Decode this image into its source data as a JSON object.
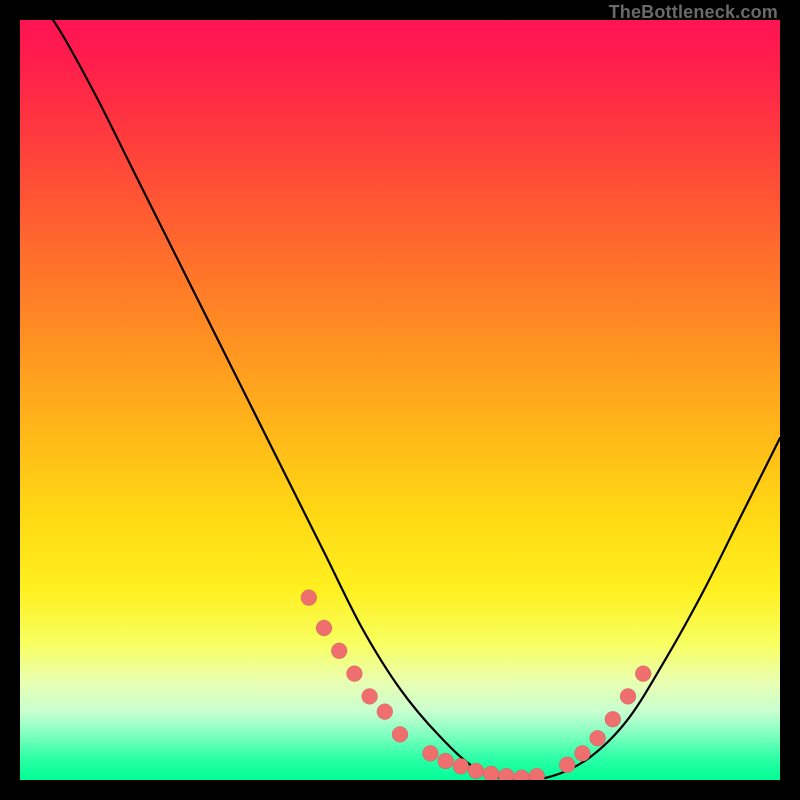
{
  "watermark": "TheBottleneck.com",
  "colors": {
    "background": "#000000",
    "gradient_top": "#ff1454",
    "gradient_bottom": "#00ff98",
    "curve": "#000000",
    "dot": "#ef6f6f"
  },
  "chart_data": {
    "type": "line",
    "title": "",
    "xlabel": "",
    "ylabel": "",
    "xlim": [
      0,
      100
    ],
    "ylim": [
      0,
      100
    ],
    "x": [
      0,
      5,
      10,
      15,
      20,
      25,
      30,
      35,
      40,
      45,
      50,
      55,
      60,
      65,
      70,
      75,
      80,
      85,
      90,
      95,
      100
    ],
    "values": [
      106,
      99,
      90,
      80,
      70,
      60,
      50,
      40,
      30,
      20,
      12,
      6,
      1.5,
      0,
      0.5,
      3,
      8,
      16,
      25,
      35,
      45
    ],
    "dots_x": [
      38,
      40,
      42,
      44,
      46,
      48,
      50,
      54,
      56,
      58,
      60,
      62,
      64,
      66,
      68,
      72,
      74,
      76,
      78,
      80,
      82
    ],
    "dots_y": [
      24,
      20,
      17,
      14,
      11,
      9,
      6,
      3.5,
      2.5,
      1.8,
      1.2,
      0.8,
      0.5,
      0.3,
      0.5,
      2,
      3.5,
      5.5,
      8,
      11,
      14
    ]
  }
}
